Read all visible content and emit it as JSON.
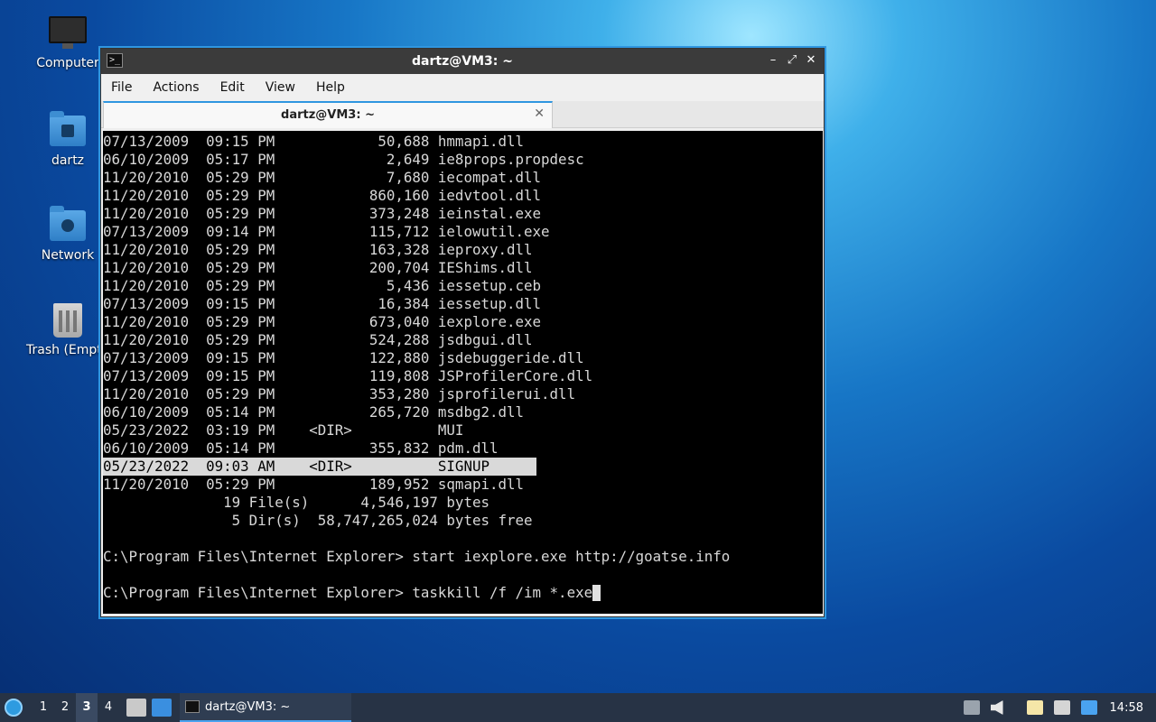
{
  "desktop": {
    "icons": [
      {
        "label": "Computer"
      },
      {
        "label": "dartz"
      },
      {
        "label": "Network"
      },
      {
        "label": "Trash (Empty)"
      }
    ]
  },
  "window": {
    "title": "dartz@VM3: ~",
    "icon_text": ">_",
    "controls": {
      "minimize": "–",
      "maximize": "⤢",
      "close": "✕"
    },
    "menu": [
      "File",
      "Actions",
      "Edit",
      "View",
      "Help"
    ],
    "tab": {
      "label": "dartz@VM3: ~",
      "close": "✕"
    }
  },
  "terminal": {
    "lines": [
      "07/13/2009  09:15 PM            50,688 hmmapi.dll",
      "06/10/2009  05:17 PM             2,649 ie8props.propdesc",
      "11/20/2010  05:29 PM             7,680 iecompat.dll",
      "11/20/2010  05:29 PM           860,160 iedvtool.dll",
      "11/20/2010  05:29 PM           373,248 ieinstal.exe",
      "07/13/2009  09:14 PM           115,712 ielowutil.exe",
      "11/20/2010  05:29 PM           163,328 ieproxy.dll",
      "11/20/2010  05:29 PM           200,704 IEShims.dll",
      "11/20/2010  05:29 PM             5,436 iessetup.ceb",
      "07/13/2009  09:15 PM            16,384 iessetup.dll",
      "11/20/2010  05:29 PM           673,040 iexplore.exe",
      "11/20/2010  05:29 PM           524,288 jsdbgui.dll",
      "07/13/2009  09:15 PM           122,880 jsdebuggeride.dll",
      "07/13/2009  09:15 PM           119,808 JSProfilerCore.dll",
      "11/20/2010  05:29 PM           353,280 jsprofilerui.dll",
      "06/10/2009  05:14 PM           265,720 msdbg2.dll",
      "05/23/2022  03:19 PM    <DIR>          MUI",
      "06/10/2009  05:14 PM           355,832 pdm.dll",
      "05/23/2022  09:03 AM    <DIR>          SIGNUP",
      "11/20/2010  05:29 PM           189,952 sqmapi.dll",
      "              19 File(s)      4,546,197 bytes",
      "               5 Dir(s)  58,747,265,024 bytes free",
      "",
      "C:\\Program Files\\Internet Explorer> start iexplore.exe http://goatse.info",
      "",
      "C:\\Program Files\\Internet Explorer> taskkill /f /im *.exe"
    ]
  },
  "taskbar": {
    "workspaces": [
      "1",
      "2",
      "3",
      "4"
    ],
    "active_workspace": "3",
    "task": {
      "label": "dartz@VM3: ~"
    },
    "clock": "14:58"
  }
}
